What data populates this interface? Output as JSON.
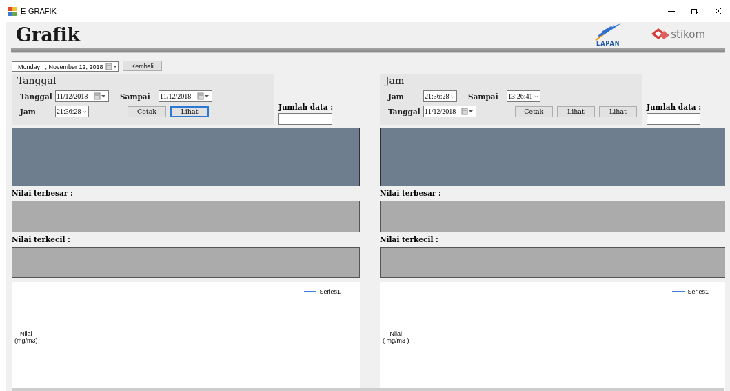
{
  "window": {
    "title": "E-GRAFIK"
  },
  "header": {
    "title": "Grafik",
    "logos": [
      {
        "kind": "lapan",
        "text": "LAPAN"
      },
      {
        "kind": "stikom",
        "text": "stikom"
      }
    ]
  },
  "panels": [
    {
      "top_bar": {
        "date_picker": "Monday   , November 12, 2018",
        "button": "Kembali"
      },
      "group_title": "Tanggal",
      "rows": [
        [
          {
            "kind": "label",
            "text": "Tanggal"
          },
          {
            "kind": "date",
            "value": "11/12/2018"
          },
          {
            "kind": "label",
            "text": "Sampai"
          },
          {
            "kind": "date",
            "value": "11/12/2018"
          }
        ],
        [
          {
            "kind": "label",
            "text": "Jam"
          },
          {
            "kind": "time",
            "value": "21:36:28"
          },
          {
            "kind": "button",
            "text": "Cetak",
            "focused": false
          },
          {
            "kind": "button",
            "text": "Lihat",
            "focused": true
          }
        ]
      ],
      "count_label": "Jumlah data :",
      "max_label": "Nilai terbesar :",
      "min_label": "Nilai terkecil :",
      "chart": {
        "legend": "Series1",
        "color": "#3a7fe0",
        "ylabel": "Nilai\n(mg/m3)"
      }
    },
    {
      "group_title": "Jam",
      "rows": [
        [
          {
            "kind": "label",
            "text": "Jam"
          },
          {
            "kind": "time",
            "value": "21:36:28"
          },
          {
            "kind": "label",
            "text": "Sampai"
          },
          {
            "kind": "time",
            "value": "13:26:41"
          }
        ],
        [
          {
            "kind": "label",
            "text": "Tanggal"
          },
          {
            "kind": "date",
            "value": "11/12/2018"
          },
          {
            "kind": "button",
            "text": "Cetak",
            "focused": false
          },
          {
            "kind": "button",
            "text": "Lihat",
            "focused": false
          },
          {
            "kind": "button",
            "text": "Lihat",
            "focused": false
          }
        ]
      ],
      "count_label": "Jumlah data :",
      "max_label": "Nilai terbesar :",
      "min_label": "Nilai terkecil :",
      "chart": {
        "legend": "Series1",
        "color": "#3a7fe0",
        "ylabel": "Nilai\n( mg/m3 )"
      }
    }
  ]
}
